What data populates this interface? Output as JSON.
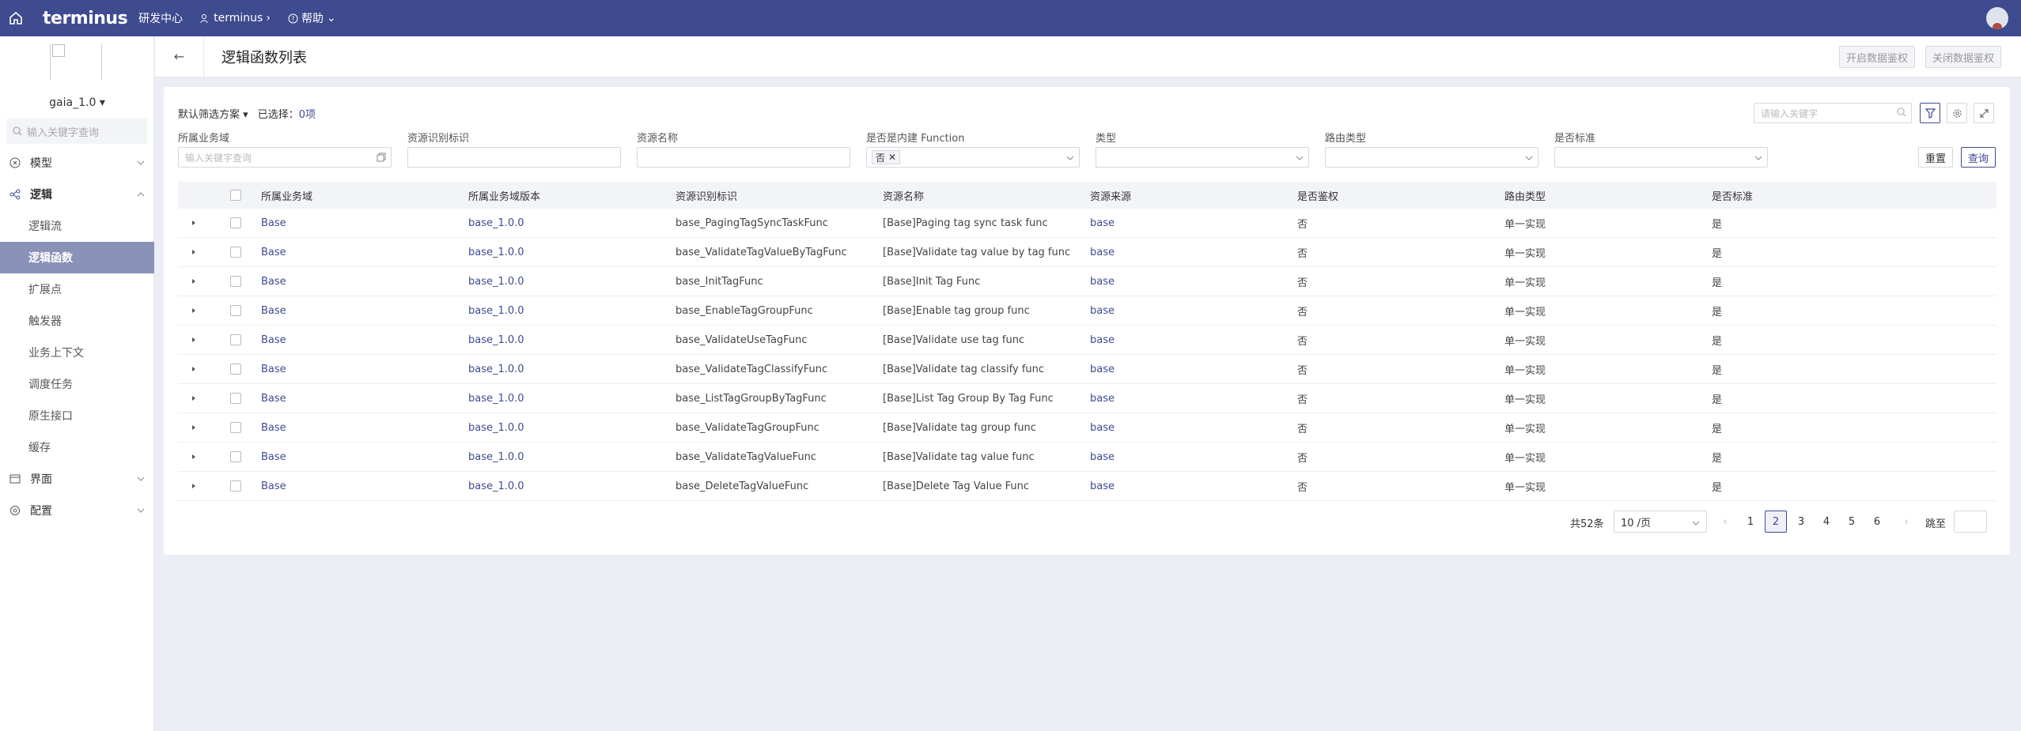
{
  "topbar": {
    "logo": "terminus",
    "center_title": "研发中心",
    "org_nav": "terminus",
    "help": "帮助",
    "colors": {
      "bar": "#3f4b8f"
    }
  },
  "sidebar": {
    "app_name": "gaia_1.0",
    "search_placeholder": "输入关键字查询",
    "groups": [
      {
        "label": "模型",
        "icon": "model-icon"
      },
      {
        "label": "逻辑",
        "icon": "logic-icon",
        "expanded": true
      },
      {
        "label": "界面",
        "icon": "ui-icon"
      },
      {
        "label": "配置",
        "icon": "config-icon"
      }
    ],
    "logic_items": [
      "逻辑流",
      "逻辑函数",
      "扩展点",
      "触发器",
      "业务上下文",
      "调度任务",
      "原生接口",
      "缓存"
    ],
    "active_item": "逻辑函数"
  },
  "header": {
    "title": "逻辑函数列表",
    "btn_enable_auth": "开启数据鉴权",
    "btn_disable_auth": "关闭数据鉴权"
  },
  "filter": {
    "scheme": "默认筛选方案",
    "selected_label": "已选择：",
    "selected_count": "0项",
    "keyword_placeholder": "请输入关键字",
    "fields": {
      "domain_label": "所属业务域",
      "domain_placeholder": "输入关键字查询",
      "resource_key_label": "资源识别标识",
      "resource_name_label": "资源名称",
      "builtin_label": "是否是内建 Function",
      "builtin_value": "否",
      "type_label": "类型",
      "route_type_label": "路由类型",
      "standard_label": "是否标准"
    },
    "reset": "重置",
    "query": "查询"
  },
  "table": {
    "headers": [
      "所属业务域",
      "所属业务域版本",
      "资源识别标识",
      "资源名称",
      "资源来源",
      "是否鉴权",
      "路由类型",
      "是否标准"
    ],
    "rows": [
      [
        "Base",
        "base_1.0.0",
        "base_PagingTagSyncTaskFunc",
        "[Base]Paging tag sync task func",
        "base",
        "否",
        "单一实现",
        "是"
      ],
      [
        "Base",
        "base_1.0.0",
        "base_ValidateTagValueByTagFunc",
        "[Base]Validate tag value by tag func",
        "base",
        "否",
        "单一实现",
        "是"
      ],
      [
        "Base",
        "base_1.0.0",
        "base_InitTagFunc",
        "[Base]Init Tag Func",
        "base",
        "否",
        "单一实现",
        "是"
      ],
      [
        "Base",
        "base_1.0.0",
        "base_EnableTagGroupFunc",
        "[Base]Enable tag group func",
        "base",
        "否",
        "单一实现",
        "是"
      ],
      [
        "Base",
        "base_1.0.0",
        "base_ValidateUseTagFunc",
        "[Base]Validate use tag func",
        "base",
        "否",
        "单一实现",
        "是"
      ],
      [
        "Base",
        "base_1.0.0",
        "base_ValidateTagClassifyFunc",
        "[Base]Validate tag classify func",
        "base",
        "否",
        "单一实现",
        "是"
      ],
      [
        "Base",
        "base_1.0.0",
        "base_ListTagGroupByTagFunc",
        "[Base]List Tag Group By Tag Func",
        "base",
        "否",
        "单一实现",
        "是"
      ],
      [
        "Base",
        "base_1.0.0",
        "base_ValidateTagGroupFunc",
        "[Base]Validate tag group func",
        "base",
        "否",
        "单一实现",
        "是"
      ],
      [
        "Base",
        "base_1.0.0",
        "base_ValidateTagValueFunc",
        "[Base]Validate tag value func",
        "base",
        "否",
        "单一实现",
        "是"
      ],
      [
        "Base",
        "base_1.0.0",
        "base_DeleteTagValueFunc",
        "[Base]Delete Tag Value Func",
        "base",
        "否",
        "单一实现",
        "是"
      ]
    ]
  },
  "pagination": {
    "total": "共52条",
    "page_size": "10 /页",
    "pages": [
      "1",
      "2",
      "3",
      "4",
      "5",
      "6"
    ],
    "current": "2",
    "jump_label": "跳至"
  }
}
